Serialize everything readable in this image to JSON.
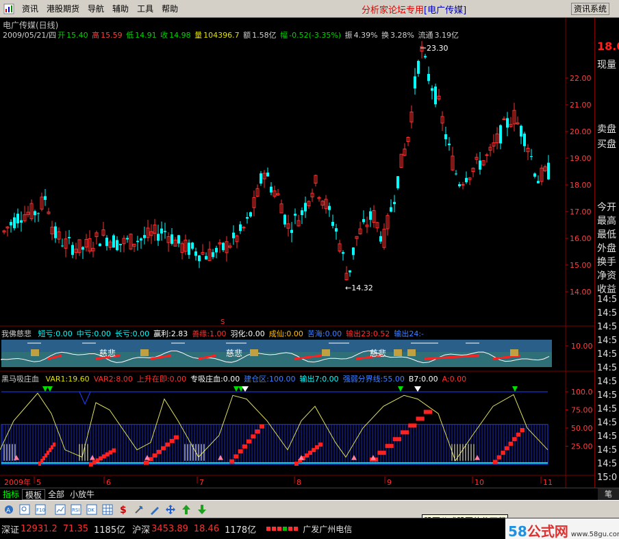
{
  "menu": {
    "items": [
      "资讯",
      "港股期货",
      "导航",
      "辅助",
      "工具",
      "帮助"
    ],
    "brand": "分析家论坛专用",
    "stock_tag": "[电广传媒]",
    "sys_button": "资讯系统"
  },
  "quote": {
    "title": "电广传媒(日线)",
    "date": "2009/05/21/四",
    "open_label": "开",
    "open": "15.40",
    "high_label": "高",
    "high": "15.59",
    "low_label": "低",
    "low": "14.91",
    "close_label": "收",
    "close": "14.98",
    "vol_label": "量",
    "vol": "104396.7",
    "amount_label": "额",
    "amount": "1.58亿",
    "change_label": "幅",
    "change": "-0.52(-3.35%)",
    "amp_label": "振",
    "amp": "4.39%",
    "turn_label": "换",
    "turn": "3.28%",
    "float_label": "流通",
    "float": "3.19亿"
  },
  "price_axis": [
    "22.00",
    "21.00",
    "20.00",
    "19.00",
    "18.00",
    "17.00",
    "16.00",
    "15.00",
    "14.00"
  ],
  "annotations": {
    "high": "23.30",
    "low": "14.32",
    "signal": "S"
  },
  "indicator1": {
    "name": "我佛慈悲",
    "items": [
      {
        "label": "短亏:0.00",
        "color": "#00ffff"
      },
      {
        "label": "中亏:0.00",
        "color": "#00ffff"
      },
      {
        "label": "长亏:0.00",
        "color": "#00ffff"
      },
      {
        "label": "赢利:2.83",
        "color": "#ffffff"
      },
      {
        "label": "善缘:1.00",
        "color": "#ff3030"
      },
      {
        "label": "羽化:0.00",
        "color": "#ffffff"
      },
      {
        "label": "成仙:0.00",
        "color": "#ffc000"
      },
      {
        "label": "苦海:0.00",
        "color": "#4080ff"
      },
      {
        "label": "输出23:0.52",
        "color": "#ff3030"
      },
      {
        "label": "输出24:-",
        "color": "#4080ff"
      }
    ],
    "axis": "10.00",
    "stamp": "慈悲"
  },
  "indicator2": {
    "name": "黑马吸庄血",
    "items": [
      {
        "label": "VAR1:19.60",
        "color": "#e0e000"
      },
      {
        "label": "VAR2:8.00",
        "color": "#ff3030"
      },
      {
        "label": "上升在即:0.00",
        "color": "#ff3030"
      },
      {
        "label": "专吸庄血:0.00",
        "color": "#ffffff"
      },
      {
        "label": "建仓区:100.00",
        "color": "#4080ff"
      },
      {
        "label": "输出7:0.00",
        "color": "#00ffff"
      },
      {
        "label": "强弱分界线:55.00",
        "color": "#4080ff"
      },
      {
        "label": "B7:0.00",
        "color": "#ffffff"
      },
      {
        "label": "A:0.00",
        "color": "#ff3030"
      }
    ],
    "axis": [
      "100.0",
      "75.00",
      "50.00",
      "25.00"
    ]
  },
  "x_axis": {
    "year": "2009年",
    "months": [
      "5",
      "6",
      "7",
      "8",
      "9",
      "10",
      "11"
    ]
  },
  "period_label": "日线",
  "right_panel": {
    "price": "18.0",
    "labels": [
      "现量",
      "卖盘",
      "买盘",
      "今开",
      "最高",
      "最低",
      "外盘",
      "换手",
      "净资",
      "收益"
    ],
    "times": [
      "14:5",
      "14:5",
      "14:5",
      "14:5",
      "14:5",
      "14:5",
      "14:5",
      "14:5",
      "14:5",
      "14:5",
      "14:5",
      "14:5",
      "14:5",
      "15:0"
    ]
  },
  "tabs": [
    "指标",
    "模板",
    "全部",
    "小放牛"
  ],
  "tab_right": "笔",
  "toolbar_tip": "股票公式股票软件下载",
  "status": {
    "sz_label": "深证",
    "sz_index": "12931.2",
    "sz_change": "71.35",
    "sz_amount": "1185亿",
    "hs_label": "沪深",
    "hs_index": "3453.89",
    "hs_change": "18.46",
    "hs_amount": "1178亿",
    "isp": "广发广州电信"
  },
  "watermark": {
    "a": "58",
    "b": "公式网",
    "url": "www.58gu.com"
  }
}
